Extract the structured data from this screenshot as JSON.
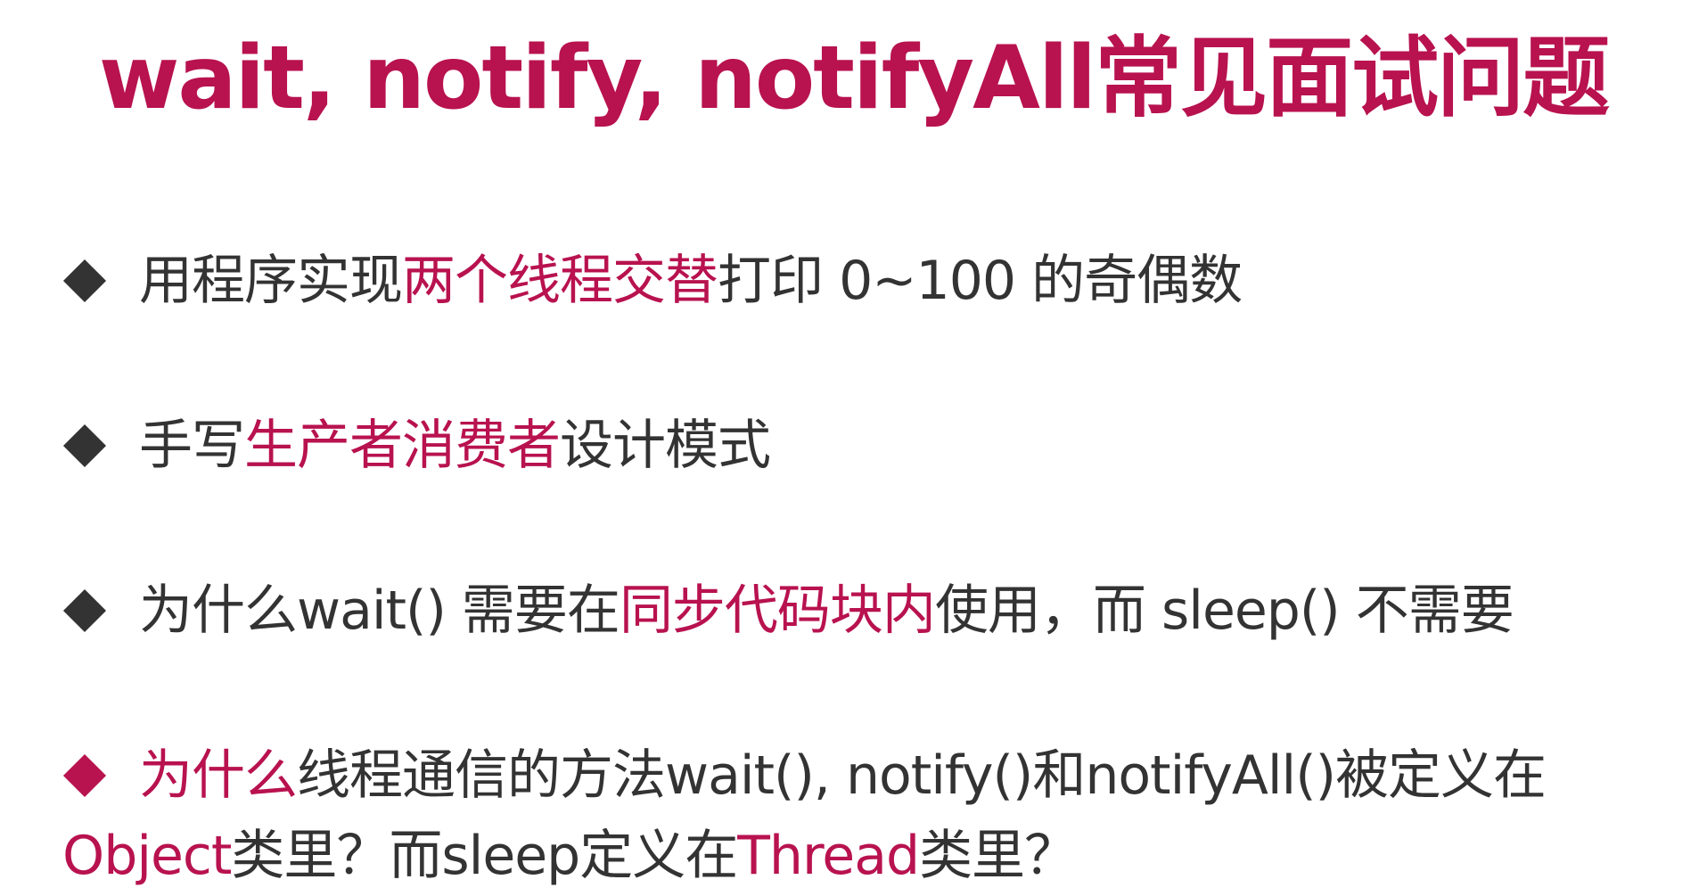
{
  "title": "wait, notify, notifyAll常见面试问题",
  "colors": {
    "accent": "#b8124f",
    "text": "#333333",
    "background": "#ffffff"
  },
  "bullets": [
    {
      "marker_color": "#333333",
      "parts": [
        "用程序实现",
        "两个线程交替",
        "打印 0~100 的奇偶数"
      ]
    },
    {
      "marker_color": "#333333",
      "parts": [
        "手写",
        "生产者消费者",
        "设计模式"
      ]
    },
    {
      "marker_color": "#333333",
      "parts": [
        "为什么wait() 需要在",
        "同步代码块内",
        "使用，而 sleep() 不需要"
      ]
    },
    {
      "marker_color": "#b8124f",
      "line1": [
        "为什么",
        "线程通信的方法wait(), notify()和notifyAll()被定义在"
      ],
      "line2": [
        "Object",
        "类里？而sleep定义在",
        "Thread",
        "类里？"
      ]
    }
  ]
}
